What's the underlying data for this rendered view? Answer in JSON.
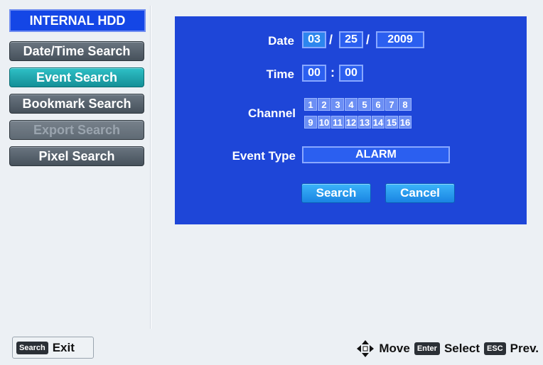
{
  "sidebar": {
    "title": "INTERNAL HDD",
    "items": [
      {
        "label": "Date/Time Search",
        "state": "normal"
      },
      {
        "label": "Event Search",
        "state": "active"
      },
      {
        "label": "Bookmark Search",
        "state": "normal"
      },
      {
        "label": "Export Search",
        "state": "disabled"
      },
      {
        "label": "Pixel Search",
        "state": "normal"
      }
    ]
  },
  "form": {
    "date_label": "Date",
    "date_month": "03",
    "date_day": "25",
    "date_year": "2009",
    "date_separator": "/",
    "time_label": "Time",
    "time_hour": "00",
    "time_minute": "00",
    "time_separator": ":",
    "channel_label": "Channel",
    "channels": [
      "1",
      "2",
      "3",
      "4",
      "5",
      "6",
      "7",
      "8",
      "9",
      "10",
      "11",
      "12",
      "13",
      "14",
      "15",
      "16"
    ],
    "event_type_label": "Event Type",
    "event_type_value": "ALARM",
    "search_label": "Search",
    "cancel_label": "Cancel"
  },
  "footer": {
    "exit_key": "Search",
    "exit_label": "Exit",
    "move_label": "Move",
    "enter_key": "Enter",
    "select_label": "Select",
    "esc_key": "ESC",
    "prev_label": "Prev."
  },
  "colors": {
    "panel_bg": "#1e46d8",
    "active_item": "#2fc0c6",
    "hdd_header": "#1446e6",
    "button_blue": "#2a98f0"
  },
  "icons": {
    "move": "four-way-arrows-icon"
  }
}
